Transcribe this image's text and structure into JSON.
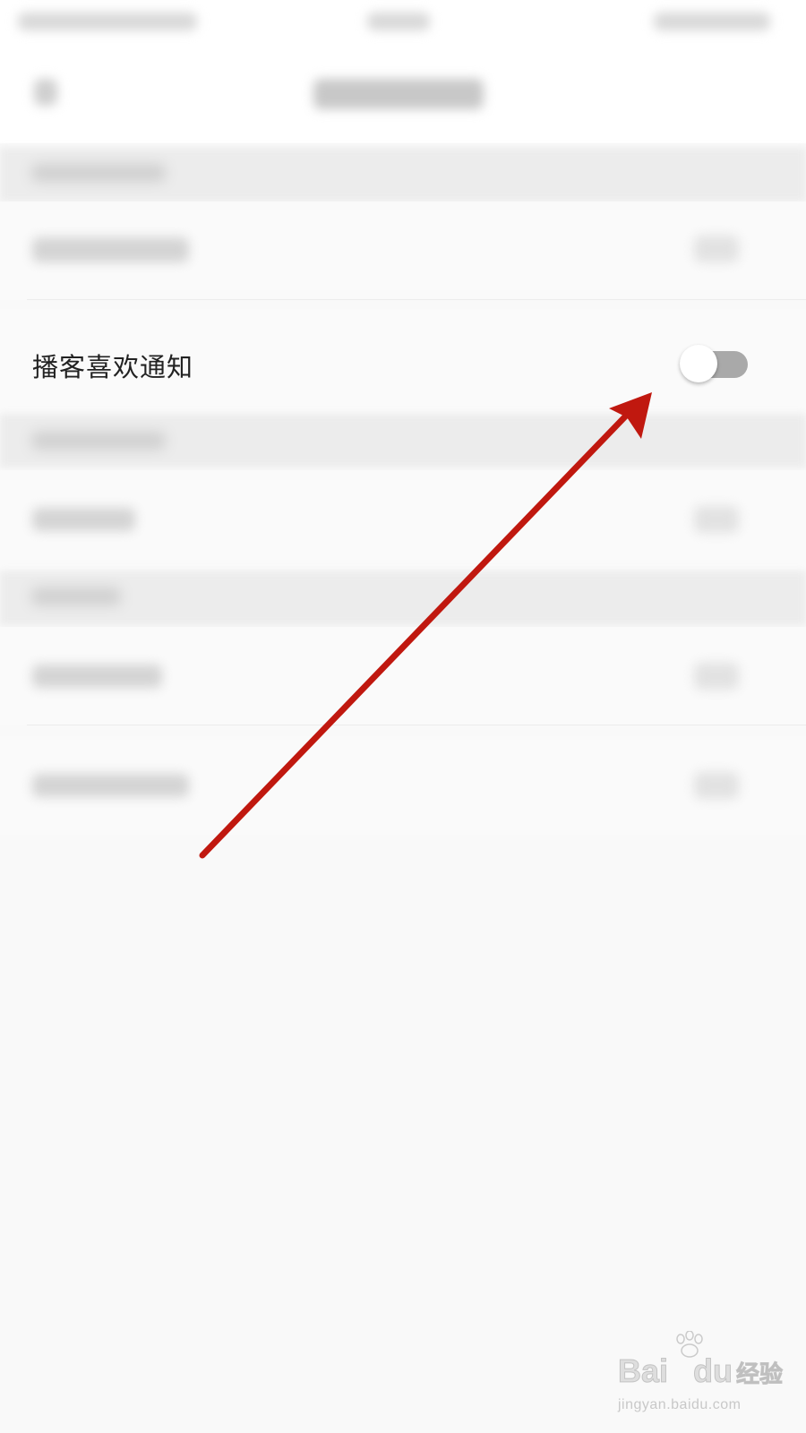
{
  "settings": {
    "focused_item": {
      "label": "播客喜欢通知",
      "toggle_state": "off"
    }
  },
  "colors": {
    "annotation_arrow": "#c0180f",
    "toggle_track_off": "#a9a9a9",
    "toggle_knob": "#ffffff",
    "background": "#f9f9f9"
  },
  "watermark": {
    "brand_latin": "Bai",
    "brand_latin_2": "du",
    "brand_cn": "经验",
    "url": "jingyan.baidu.com"
  }
}
